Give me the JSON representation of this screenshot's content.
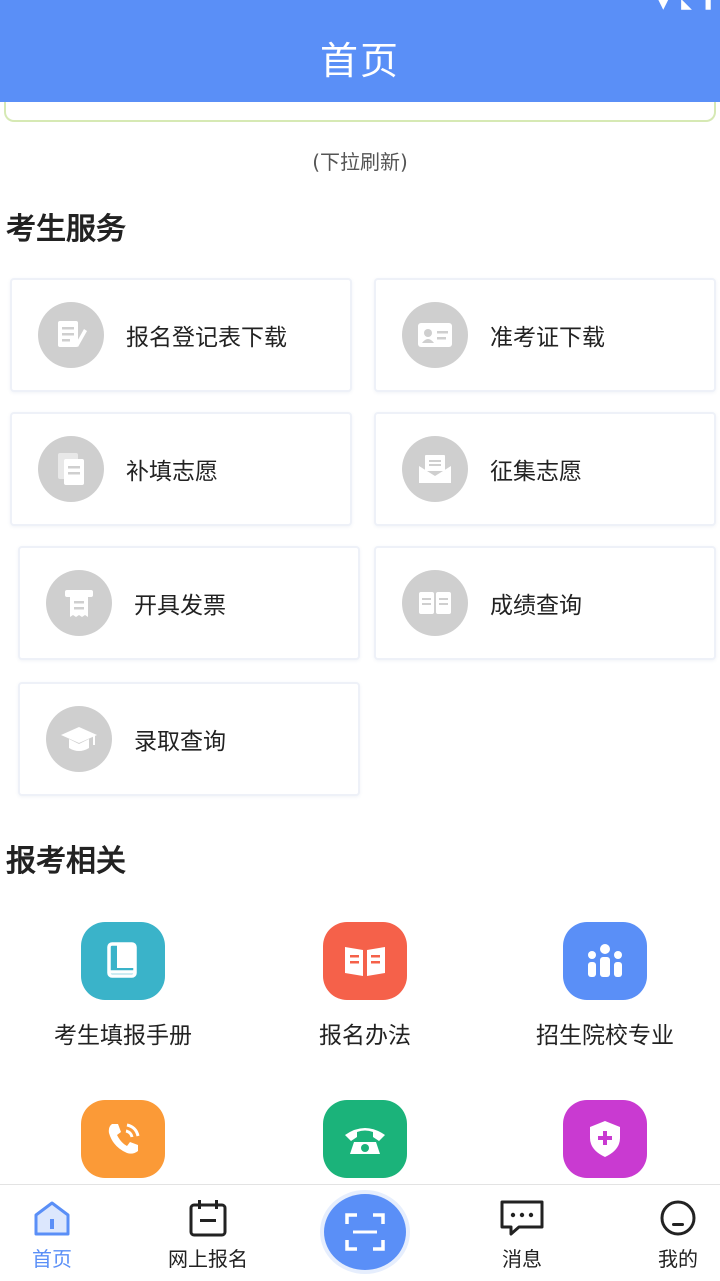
{
  "header": {
    "title": "首页"
  },
  "pull_hint": "(下拉刷新)",
  "services": {
    "title": "考生服务",
    "items": [
      {
        "label": "报名登记表下载",
        "icon": "form-edit-icon"
      },
      {
        "label": "准考证下载",
        "icon": "id-card-icon"
      },
      {
        "label": "补填志愿",
        "icon": "document-copy-icon"
      },
      {
        "label": "征集志愿",
        "icon": "mail-open-icon"
      },
      {
        "label": "开具发票",
        "icon": "receipt-icon"
      },
      {
        "label": "成绩查询",
        "icon": "open-book-icon"
      },
      {
        "label": "录取查询",
        "icon": "graduation-cap-icon"
      }
    ]
  },
  "related": {
    "title": "报考相关",
    "items": [
      {
        "label": "考生填报手册",
        "icon": "handbook-icon",
        "color": "#3ab3c9"
      },
      {
        "label": "报名办法",
        "icon": "book-icon",
        "color": "#f5614a"
      },
      {
        "label": "招生院校专业",
        "icon": "people-icon",
        "color": "#5a8ff7"
      },
      {
        "label": "",
        "icon": "phone-icon",
        "color": "#fb9a37"
      },
      {
        "label": "",
        "icon": "telephone-icon",
        "color": "#1bb37a"
      },
      {
        "label": "",
        "icon": "shield-plus-icon",
        "color": "#c93ad1"
      }
    ]
  },
  "tabs": [
    {
      "label": "首页",
      "icon": "home-icon",
      "active": true
    },
    {
      "label": "网上报名",
      "icon": "calendar-icon"
    },
    {
      "label": "",
      "icon": "scan-icon"
    },
    {
      "label": "消息",
      "icon": "message-icon"
    },
    {
      "label": "我的",
      "icon": "user-face-icon"
    }
  ],
  "colors": {
    "accent": "#5a8ff7",
    "card_icon_bg": "#cfcfcf"
  }
}
